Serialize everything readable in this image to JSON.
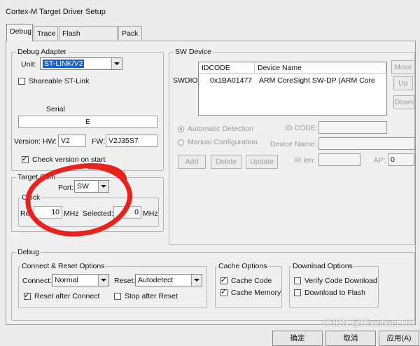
{
  "window": {
    "title": "Cortex-M Target Driver Setup"
  },
  "tabs": [
    "Debug",
    "Trace",
    "Flash Download",
    "Pack"
  ],
  "debug_adapter": {
    "legend": "Debug Adapter",
    "unit_label": "Unit:",
    "unit_value": "ST-LINK/V2",
    "shareable_label": "Shareable ST-Link",
    "shareable_checked": false,
    "serial_label": "Serial",
    "serial_value": "E",
    "version_hw_label": "Version: HW:",
    "version_hw_value": "V2",
    "fw_label": "FW:",
    "fw_value": "V2J35S7",
    "check_label": "Check version on start",
    "check_checked": true
  },
  "target_com": {
    "legend": "Target Com",
    "port_label": "Port:",
    "port_value": "SW",
    "clock_legend": "Clock",
    "reset_label": "Reset:",
    "reset_value": "10",
    "reset_unit": "MHz",
    "selected_label": "Selected:",
    "selected_value": "0",
    "selected_unit": "MHz"
  },
  "sw_device": {
    "legend": "SW Device",
    "row_label": "SWDIO",
    "columns": [
      "IDCODE",
      "Device Name"
    ],
    "rows": [
      {
        "idcode": "0x1BA01477",
        "device_name": "ARM CoreSight SW-DP (ARM Core"
      }
    ],
    "side_buttons": [
      "Move",
      "Up",
      "Down"
    ],
    "automatic_label": "Automatic Detection",
    "manual_label": "Manual Configuration",
    "id_code_label": "ID CODE:",
    "device_name_label": "Device Name:",
    "add_label": "Add",
    "delete_label": "Delete",
    "update_label": "Update",
    "ir_len_label": "IR len:",
    "ap_label": "AP:",
    "ap_value": "0"
  },
  "debug": {
    "legend": "Debug",
    "connect_reset": {
      "legend": "Connect & Reset Options",
      "connect_label": "Connect:",
      "connect_value": "Normal",
      "reset_label": "Reset:",
      "reset_value": "Autodetect",
      "reset_after_label": "Reset after Connect",
      "reset_after_checked": true,
      "stop_after_label": "Stop after Reset",
      "stop_after_checked": false
    },
    "cache": {
      "legend": "Cache Options",
      "cache_code_label": "Cache Code",
      "cache_code_checked": true,
      "cache_memory_label": "Cache Memory",
      "cache_memory_checked": true
    },
    "download": {
      "legend": "Download Options",
      "verify_label": "Verify Code Download",
      "verify_checked": false,
      "download_label": "Download to Flash",
      "download_checked": false
    }
  },
  "footer": {
    "ok_label": "确定",
    "cancel_label": "取消",
    "apply_label": "应用(A)"
  },
  "watermark": "CSDN @ChristianLUU",
  "annotation_color": "#e8231e"
}
